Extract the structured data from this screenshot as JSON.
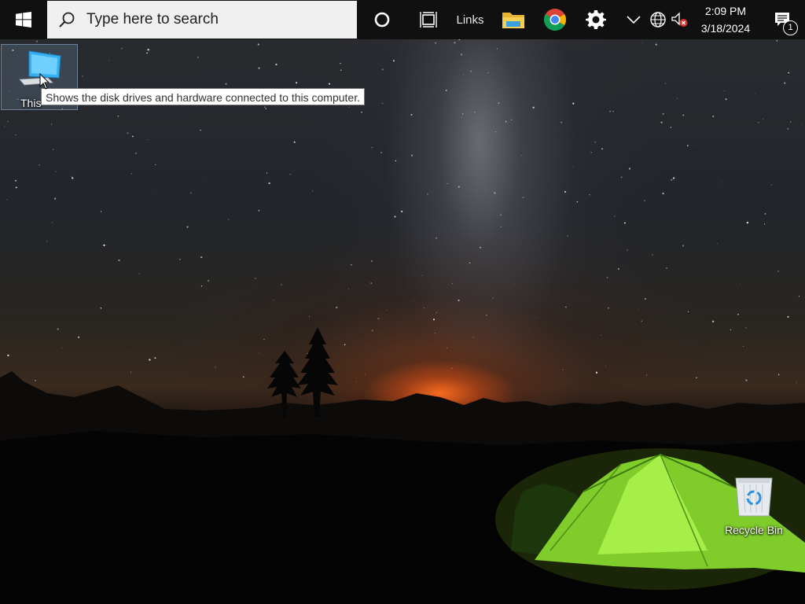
{
  "taskbar": {
    "search": {
      "placeholder": "Type here to search"
    },
    "links_label": "Links",
    "clock": {
      "time": "2:09 PM",
      "date": "3/18/2024"
    },
    "notifications_count": "1"
  },
  "desktop": {
    "icons": [
      {
        "label": "This",
        "icon": "this-pc-icon"
      },
      {
        "label": "Recycle Bin",
        "icon": "recycle-bin-icon"
      }
    ],
    "tooltip": "Shows the disk drives and hardware connected to this computer."
  },
  "colors": {
    "taskbar_bg": "#101010",
    "search_bg": "#f0f0f0",
    "tent_green": "#8fe03a",
    "horizon_glow": "#ff6e1e"
  }
}
